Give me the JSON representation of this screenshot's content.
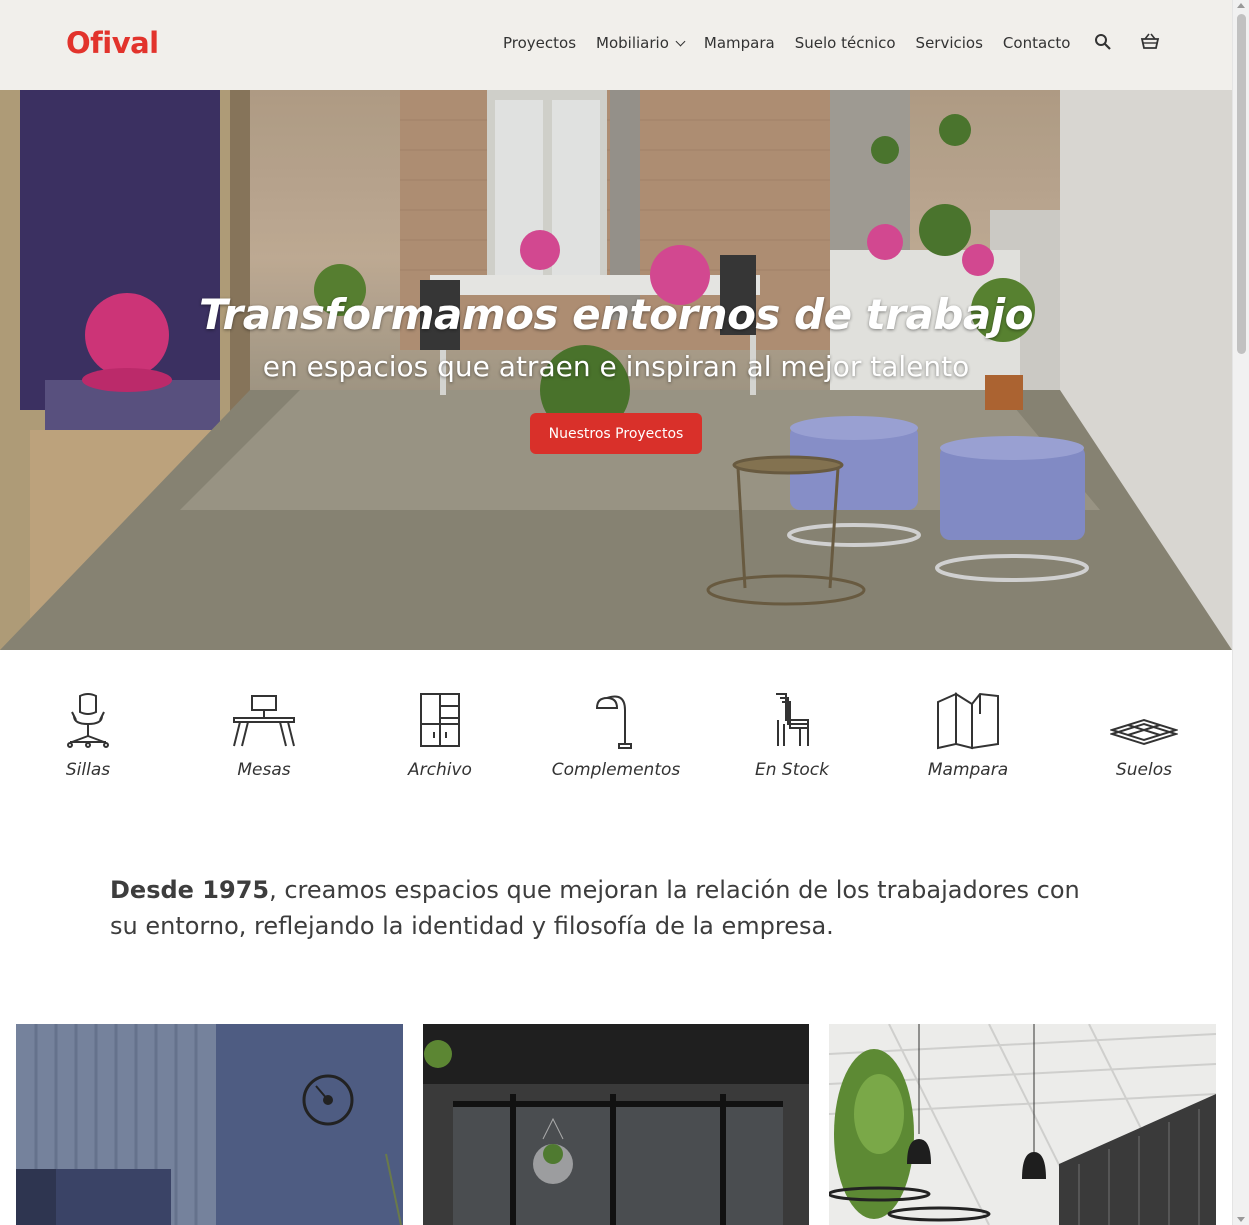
{
  "header": {
    "logo": "Ofival",
    "nav": [
      {
        "label": "Proyectos"
      },
      {
        "label": "Mobiliario",
        "has_dropdown": true
      },
      {
        "label": "Mampara"
      },
      {
        "label": "Suelo técnico"
      },
      {
        "label": "Servicios"
      },
      {
        "label": "Contacto"
      }
    ],
    "search_icon": "search-icon",
    "cart_icon": "basket-icon"
  },
  "hero": {
    "title": "Transformamos entornos de trabajo",
    "subtitle": "en espacios que atraen e inspiran al mejor talento",
    "button_label": "Nuestros Proyectos"
  },
  "categories": [
    {
      "label": "Sillas",
      "icon": "office-chair-icon"
    },
    {
      "label": "Mesas",
      "icon": "desk-icon"
    },
    {
      "label": "Archivo",
      "icon": "cabinet-icon"
    },
    {
      "label": "Complementos",
      "icon": "floor-lamp-icon"
    },
    {
      "label": "En Stock",
      "icon": "stacked-chairs-icon"
    },
    {
      "label": "Mampara",
      "icon": "partition-icon"
    },
    {
      "label": "Suelos",
      "icon": "raised-floor-icon"
    }
  ],
  "intro": {
    "bold": "Desde 1975",
    "text": ", creamos espacios que mejoran la relación de los trabajadores con su entorno, reflejando la identidad y filosofía de la empresa."
  },
  "colors": {
    "brand": "#e2332c",
    "button": "#d9302a",
    "header_bg": "#f1efeb",
    "text": "#333333"
  }
}
